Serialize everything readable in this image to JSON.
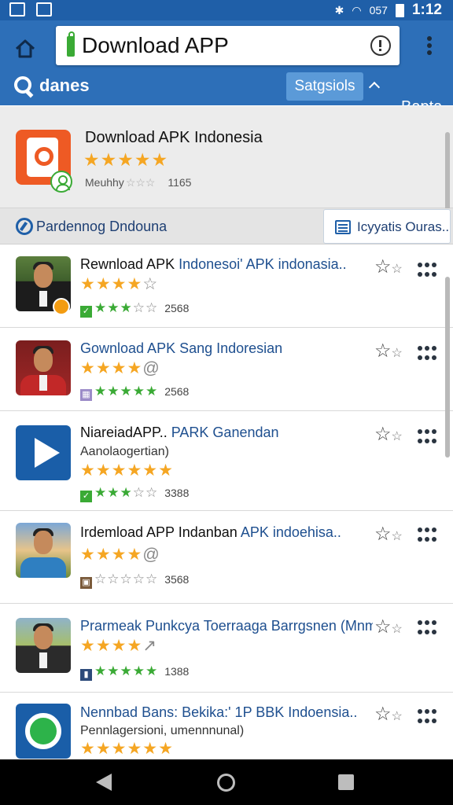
{
  "status_bar": {
    "signal_label": "057",
    "time": "1:12"
  },
  "toolbar": {
    "url": "Download APP",
    "search_label": "danes",
    "sort_label": "Satgsiols",
    "extra_tab": "Bapta"
  },
  "featured": {
    "title": "Download APK Indonesia",
    "stars": "★★★★★",
    "meta": "Meuhhy",
    "meta_ghost": "☆☆☆",
    "count": "1165"
  },
  "section": {
    "title": "Pardennog Dndouna",
    "category_label": "Icyyatis Ouras.."
  },
  "apps": [
    {
      "title": "Rewnload APK",
      "title_hl": "Indonesoi' APK indonasia..",
      "stars": "★★★★",
      "stars_empty": "☆",
      "mini_full": "★★★",
      "mini_empty": "☆☆",
      "count": "2568"
    },
    {
      "title": "Gownload APK Sang Indoresian",
      "stars": "★★★★",
      "stars_empty": "@",
      "mini_full": "★★★★★",
      "mini_empty": "",
      "count": "2568"
    },
    {
      "title": "NiareiadAPP..",
      "title_hl": "PARK Ganendan",
      "subtitle": "Aanolaogertian)",
      "stars": "★★★★★★",
      "mini_full": "★★★",
      "mini_empty": "☆☆",
      "count": "3388"
    },
    {
      "title": "Irdemload APP Indanban",
      "title_hl": "APK indoehisa..",
      "stars": "★★★★",
      "stars_empty": "@",
      "mini_full": "",
      "mini_empty": "☆☆☆☆☆",
      "count": "3568"
    },
    {
      "title": "Prarmeak Punkcya Toerraaga Barrgsnen (Mnma)..",
      "stars": "★★★★",
      "stars_empty": "↗",
      "mini_full": "★★★★★",
      "mini_empty": "",
      "count": "1388"
    },
    {
      "title": "Nennbad Bans: Bekika:' 1P BBK Indoensia..",
      "subtitle": "Pennlagersioni, umennnunal)",
      "stars": "★★★★★★"
    }
  ],
  "colors": {
    "toolbar": "#2d6fb8",
    "status": "#1f5fa8",
    "star": "#f5a623",
    "green": "#3aaa35"
  },
  "icons": [
    "home-icon",
    "lock-icon",
    "info-icon",
    "menu-dots-icon",
    "search-icon",
    "chevron-up-icon",
    "compass-icon",
    "category-icon",
    "star-outline-icon",
    "more-icon",
    "back-icon",
    "home-circle-icon",
    "recents-icon"
  ]
}
